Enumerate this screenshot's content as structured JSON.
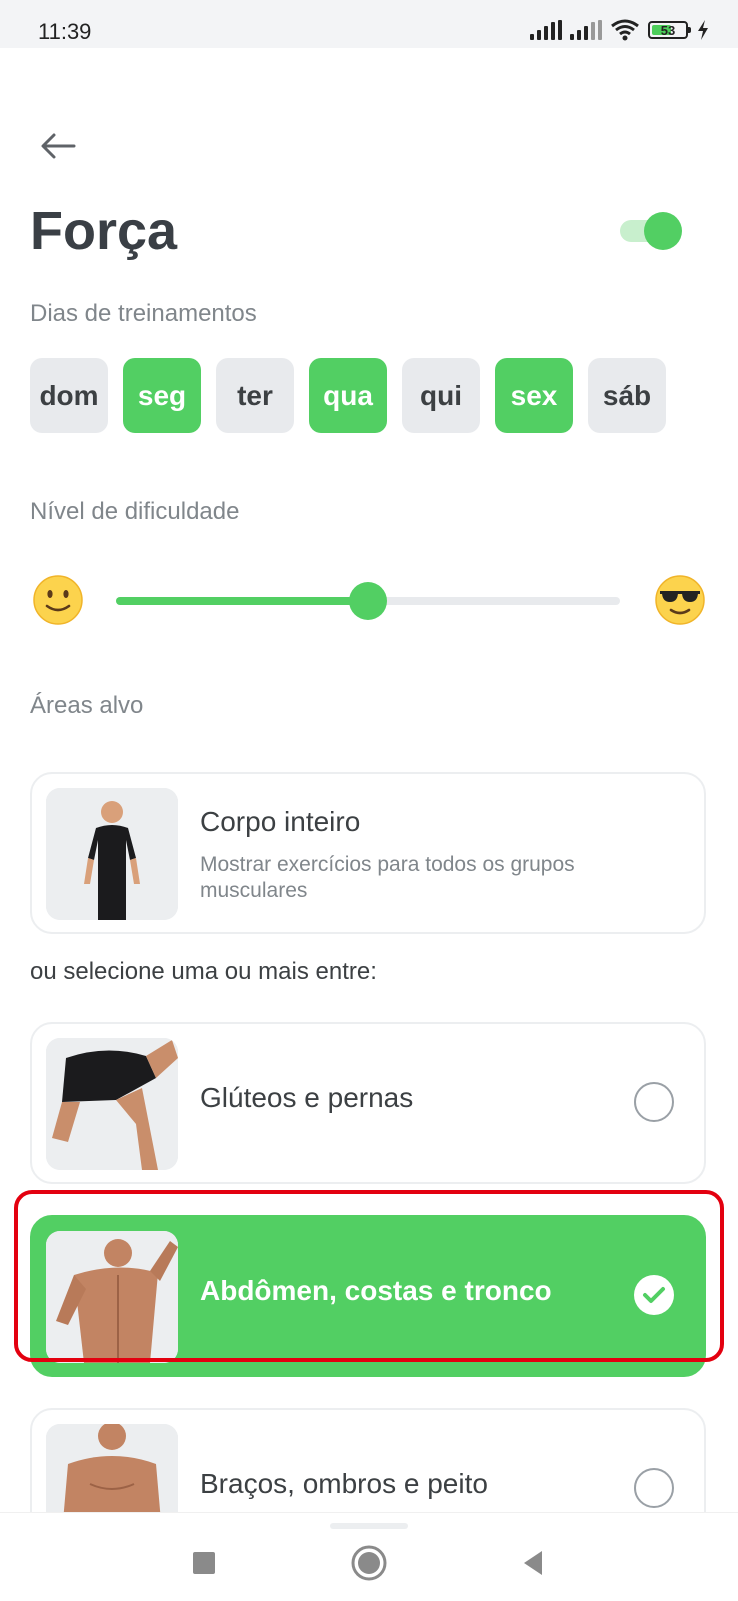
{
  "status_bar": {
    "time": "11:39",
    "battery": "53",
    "icons": [
      "signal-icon",
      "signal-icon",
      "wifi-icon",
      "battery-icon",
      "charging-icon"
    ]
  },
  "header": {
    "title": "Força",
    "toggle_on": true
  },
  "training_days": {
    "label": "Dias de treinamentos",
    "days": [
      {
        "label": "dom",
        "selected": false
      },
      {
        "label": "seg",
        "selected": true
      },
      {
        "label": "ter",
        "selected": false
      },
      {
        "label": "qua",
        "selected": true
      },
      {
        "label": "qui",
        "selected": false
      },
      {
        "label": "sex",
        "selected": true
      },
      {
        "label": "sáb",
        "selected": false
      }
    ]
  },
  "difficulty": {
    "label": "Nível de dificuldade",
    "value": 0.5,
    "min_icon": "slight-smile-emoji-icon",
    "max_icon": "sunglasses-emoji-icon"
  },
  "target_areas": {
    "label": "Áreas alvo",
    "full_body": {
      "title": "Corpo inteiro",
      "description": "Mostrar exercícios para todos os grupos musculares"
    },
    "or_text": "ou selecione uma ou mais entre:",
    "options": [
      {
        "title": "Glúteos e pernas",
        "selected": false
      },
      {
        "title": "Abdômen, costas e tronco",
        "selected": true
      },
      {
        "title": "Braços, ombros e peito",
        "selected": false
      }
    ]
  },
  "colors": {
    "accent": "#52cf63",
    "chip_off": "#e8eaed",
    "highlight": "#e3000f"
  }
}
